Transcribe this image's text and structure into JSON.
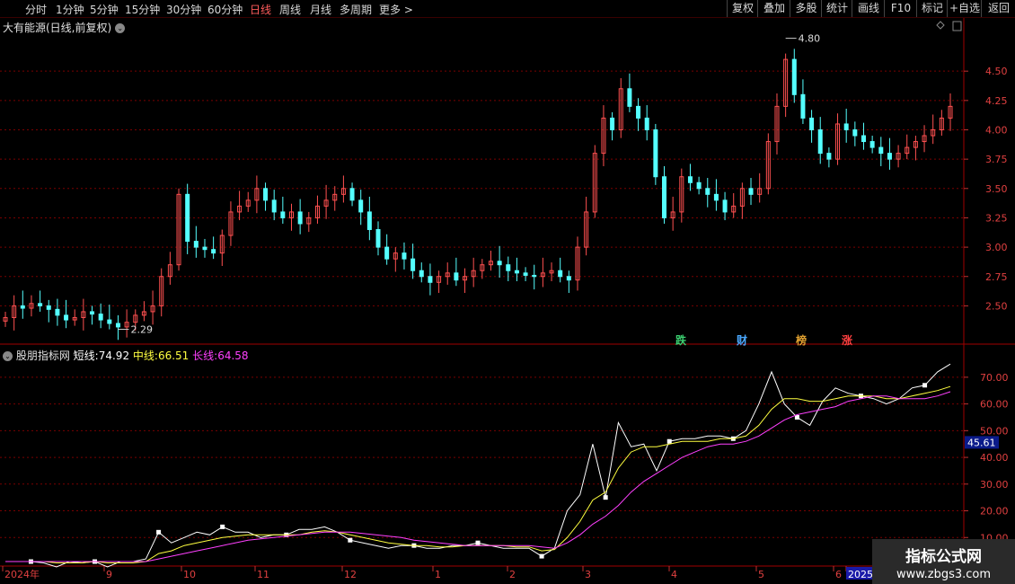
{
  "toolbar": {
    "periods": [
      {
        "label": "分时",
        "active": false
      },
      {
        "label": "1分钟",
        "active": false
      },
      {
        "label": "5分钟",
        "active": false
      },
      {
        "label": "15分钟",
        "active": false
      },
      {
        "label": "30分钟",
        "active": false
      },
      {
        "label": "60分钟",
        "active": false
      },
      {
        "label": "日线",
        "active": true
      },
      {
        "label": "周线",
        "active": false
      },
      {
        "label": "月线",
        "active": false
      },
      {
        "label": "多周期",
        "active": false
      },
      {
        "label": "更多 >",
        "active": false
      }
    ],
    "right_buttons": [
      "复权",
      "叠加",
      "多股",
      "统计",
      "画线",
      "F10",
      "标记",
      "+自选",
      "返回"
    ]
  },
  "main_panel": {
    "title": "大有能源(日线,前复权)",
    "high_label": "4.80",
    "low_label": "2.29",
    "price_ticks": [
      "4.50",
      "4.25",
      "4.00",
      "3.75",
      "3.50",
      "3.25",
      "3.00",
      "2.75",
      "2.50"
    ],
    "events": [
      {
        "label": "跌",
        "color": "#3cd070"
      },
      {
        "label": "财",
        "color": "#4aa8ff"
      },
      {
        "label": "榜",
        "color": "#e0a030"
      },
      {
        "label": "涨",
        "color": "#ff4040"
      }
    ]
  },
  "indicator": {
    "name": "股朋指标网",
    "short_label": "短线:",
    "short_value": "74.92",
    "mid_label": "中线:",
    "mid_value": "66.51",
    "long_label": "长线:",
    "long_value": "64.58",
    "ticks": [
      "70.00",
      "60.00",
      "50.00",
      "40.00",
      "30.00",
      "20.00",
      "10.00"
    ],
    "marker": "45.61",
    "colors": {
      "short": "#ffffff",
      "mid": "#ffff40",
      "long": "#ff40ff"
    }
  },
  "time_axis": [
    "2024年",
    "9",
    "10",
    "11",
    "12",
    "1",
    "2",
    "3",
    "4",
    "5",
    "6",
    "2025/"
  ],
  "watermark": {
    "line1": "指标公式网",
    "line2": "www.zbgs3.com"
  },
  "chart_data": [
    {
      "type": "candlestick",
      "title": "大有能源(日线,前复权)",
      "ylim": [
        2.35,
        4.8
      ],
      "up_color": "#ff5050",
      "down_color": "#54ffff",
      "close_approx": [
        2.4,
        2.5,
        2.48,
        2.52,
        2.5,
        2.47,
        2.42,
        2.38,
        2.4,
        2.45,
        2.43,
        2.38,
        2.35,
        2.32,
        2.36,
        2.42,
        2.45,
        2.5,
        2.75,
        2.85,
        3.45,
        3.05,
        3.0,
        2.98,
        2.95,
        3.1,
        3.3,
        3.35,
        3.4,
        3.5,
        3.4,
        3.3,
        3.25,
        3.3,
        3.2,
        3.25,
        3.35,
        3.4,
        3.45,
        3.5,
        3.4,
        3.3,
        3.15,
        3.0,
        2.9,
        2.95,
        2.9,
        2.8,
        2.75,
        2.7,
        2.75,
        2.78,
        2.72,
        2.75,
        2.8,
        2.85,
        2.88,
        2.85,
        2.8,
        2.78,
        2.76,
        2.75,
        2.78,
        2.8,
        2.75,
        2.72,
        3.0,
        3.3,
        3.8,
        4.1,
        4.0,
        4.35,
        4.2,
        4.1,
        4.0,
        3.6,
        3.25,
        3.3,
        3.6,
        3.55,
        3.5,
        3.45,
        3.4,
        3.3,
        3.35,
        3.5,
        3.45,
        3.5,
        3.9,
        4.2,
        4.6,
        4.3,
        4.1,
        4.0,
        3.8,
        3.75,
        4.05,
        4.0,
        3.95,
        3.9,
        3.85,
        3.8,
        3.75,
        3.8,
        3.85,
        3.9,
        3.95,
        4.0,
        4.1,
        4.2
      ]
    },
    {
      "type": "line",
      "series": [
        {
          "name": "短线",
          "values": [
            1,
            1,
            1,
            0.5,
            -1,
            1,
            0.5,
            1,
            -1,
            1,
            1,
            2,
            12,
            8,
            10,
            12,
            11,
            14,
            12,
            12,
            10,
            11,
            11,
            13,
            13,
            14,
            12,
            9,
            8,
            7,
            6,
            7,
            7,
            6,
            6,
            7,
            7,
            8,
            7,
            6,
            6,
            6,
            3,
            6,
            20,
            26,
            45,
            25,
            53,
            44,
            45,
            35,
            46,
            47,
            47,
            48,
            48,
            47,
            50,
            60,
            72,
            60,
            55,
            52,
            61,
            66,
            64,
            63,
            62,
            60,
            62,
            66,
            67,
            72,
            74.92
          ]
        },
        {
          "name": "中线",
          "values": [
            1,
            1,
            1,
            1,
            0.5,
            0.5,
            0.5,
            1,
            0.5,
            0.5,
            0.5,
            1,
            4,
            5,
            7,
            8,
            9,
            10,
            10.5,
            11,
            11,
            11,
            11,
            11,
            12,
            12.5,
            12,
            11,
            10,
            9,
            8,
            7.5,
            7,
            7,
            6.5,
            6.5,
            7,
            7,
            7,
            7,
            6.5,
            6.5,
            5,
            5.5,
            10,
            16,
            24,
            27,
            36,
            42,
            44,
            44,
            45,
            46,
            46,
            46,
            47,
            47,
            48,
            52,
            58,
            62,
            62,
            61,
            61,
            62,
            63,
            63,
            63,
            62,
            62,
            63,
            64,
            65,
            66.51
          ]
        },
        {
          "name": "长线",
          "values": [
            1,
            1,
            1,
            1,
            1,
            1,
            1,
            1,
            1,
            1,
            1,
            1,
            2,
            3,
            4,
            5,
            6,
            7,
            8,
            9,
            9.5,
            10,
            10.5,
            11,
            11.5,
            12,
            12,
            12,
            11.5,
            11,
            10.5,
            10,
            9,
            8.5,
            8,
            7.5,
            7,
            7,
            7,
            7,
            7,
            7,
            6.5,
            6,
            8,
            11,
            15,
            18,
            22,
            27,
            31,
            34,
            37,
            40,
            42,
            44,
            45,
            45,
            46,
            48,
            51,
            54,
            56,
            57,
            58,
            59,
            61,
            62,
            63,
            63,
            62,
            62,
            62,
            63,
            64.58
          ]
        }
      ],
      "ylim": [
        0,
        75
      ]
    }
  ]
}
